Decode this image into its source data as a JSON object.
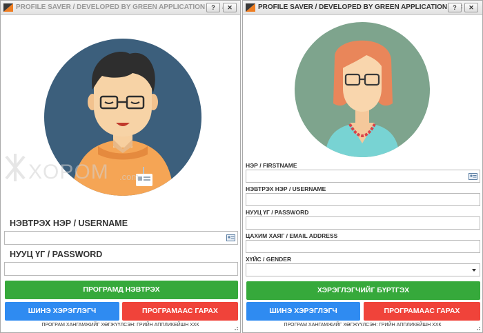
{
  "window1": {
    "title": "PROFILE SAVER /  DEVELOPED BY GREEN APPLICATION LLC /",
    "help_label": "?",
    "close_label": "✕",
    "username_label": "НЭВТРЭХ НЭР / USERNAME",
    "username_value": "",
    "password_label": "НУУЦ ҮГ / PASSWORD",
    "password_value": "",
    "login_button": "ПРОГРАМД НЭВТРЭХ",
    "new_user_button": "ШИНЭ ХЭРЭГЛЭГЧ",
    "exit_button": "ПРОГРАМААС ГАРАХ",
    "footer": "ПРОГРАМ ХАНГАМЖИЙГ ХӨГЖҮҮЛСЭН: ГРИЙН АППЛИКЕЙШН ХХК",
    "watermark_text": "XOPOM",
    "watermark_domain": ".com"
  },
  "window2": {
    "title": "PROFILE SAVER /  DEVELOPED BY GREEN APPLICATION LLC /",
    "help_label": "?",
    "close_label": "✕",
    "firstname_label": "НЭР / FIRSTNAME",
    "firstname_value": "",
    "username_label": "НЭВТРЭХ НЭР / USERNAME",
    "username_value": "",
    "password_label": "НУУЦ ҮГ / PASSWORD",
    "password_value": "",
    "email_label": "ЦАХИМ ХАЯГ / EMAIL ADDRESS",
    "email_value": "",
    "gender_label": "ХҮЙС / GENDER",
    "gender_value": "",
    "register_button": "ХЭРЭГЛЭГЧИЙГ БҮРТГЭХ",
    "new_user_button": "ШИНЭ ХЭРЭГЛЭГЧ",
    "exit_button": "ПРОГРАМААС ГАРАХ",
    "footer": "ПРОГРАМ ХАНГАМЖИЙГ ХӨГЖҮҮЛСЭН: ГРИЙН АППЛИКЕЙШН ХХК"
  },
  "colors": {
    "green": "#36a93b",
    "blue": "#2f8bf1",
    "red": "#f0433a",
    "avatar_male_bg": "#3c5f7c",
    "avatar_female_bg": "#7ea48d"
  },
  "icons": [
    "app-icon",
    "help-icon",
    "close-icon",
    "contact-card-icon",
    "dropdown-arrow-icon",
    "size-grip-icon"
  ]
}
